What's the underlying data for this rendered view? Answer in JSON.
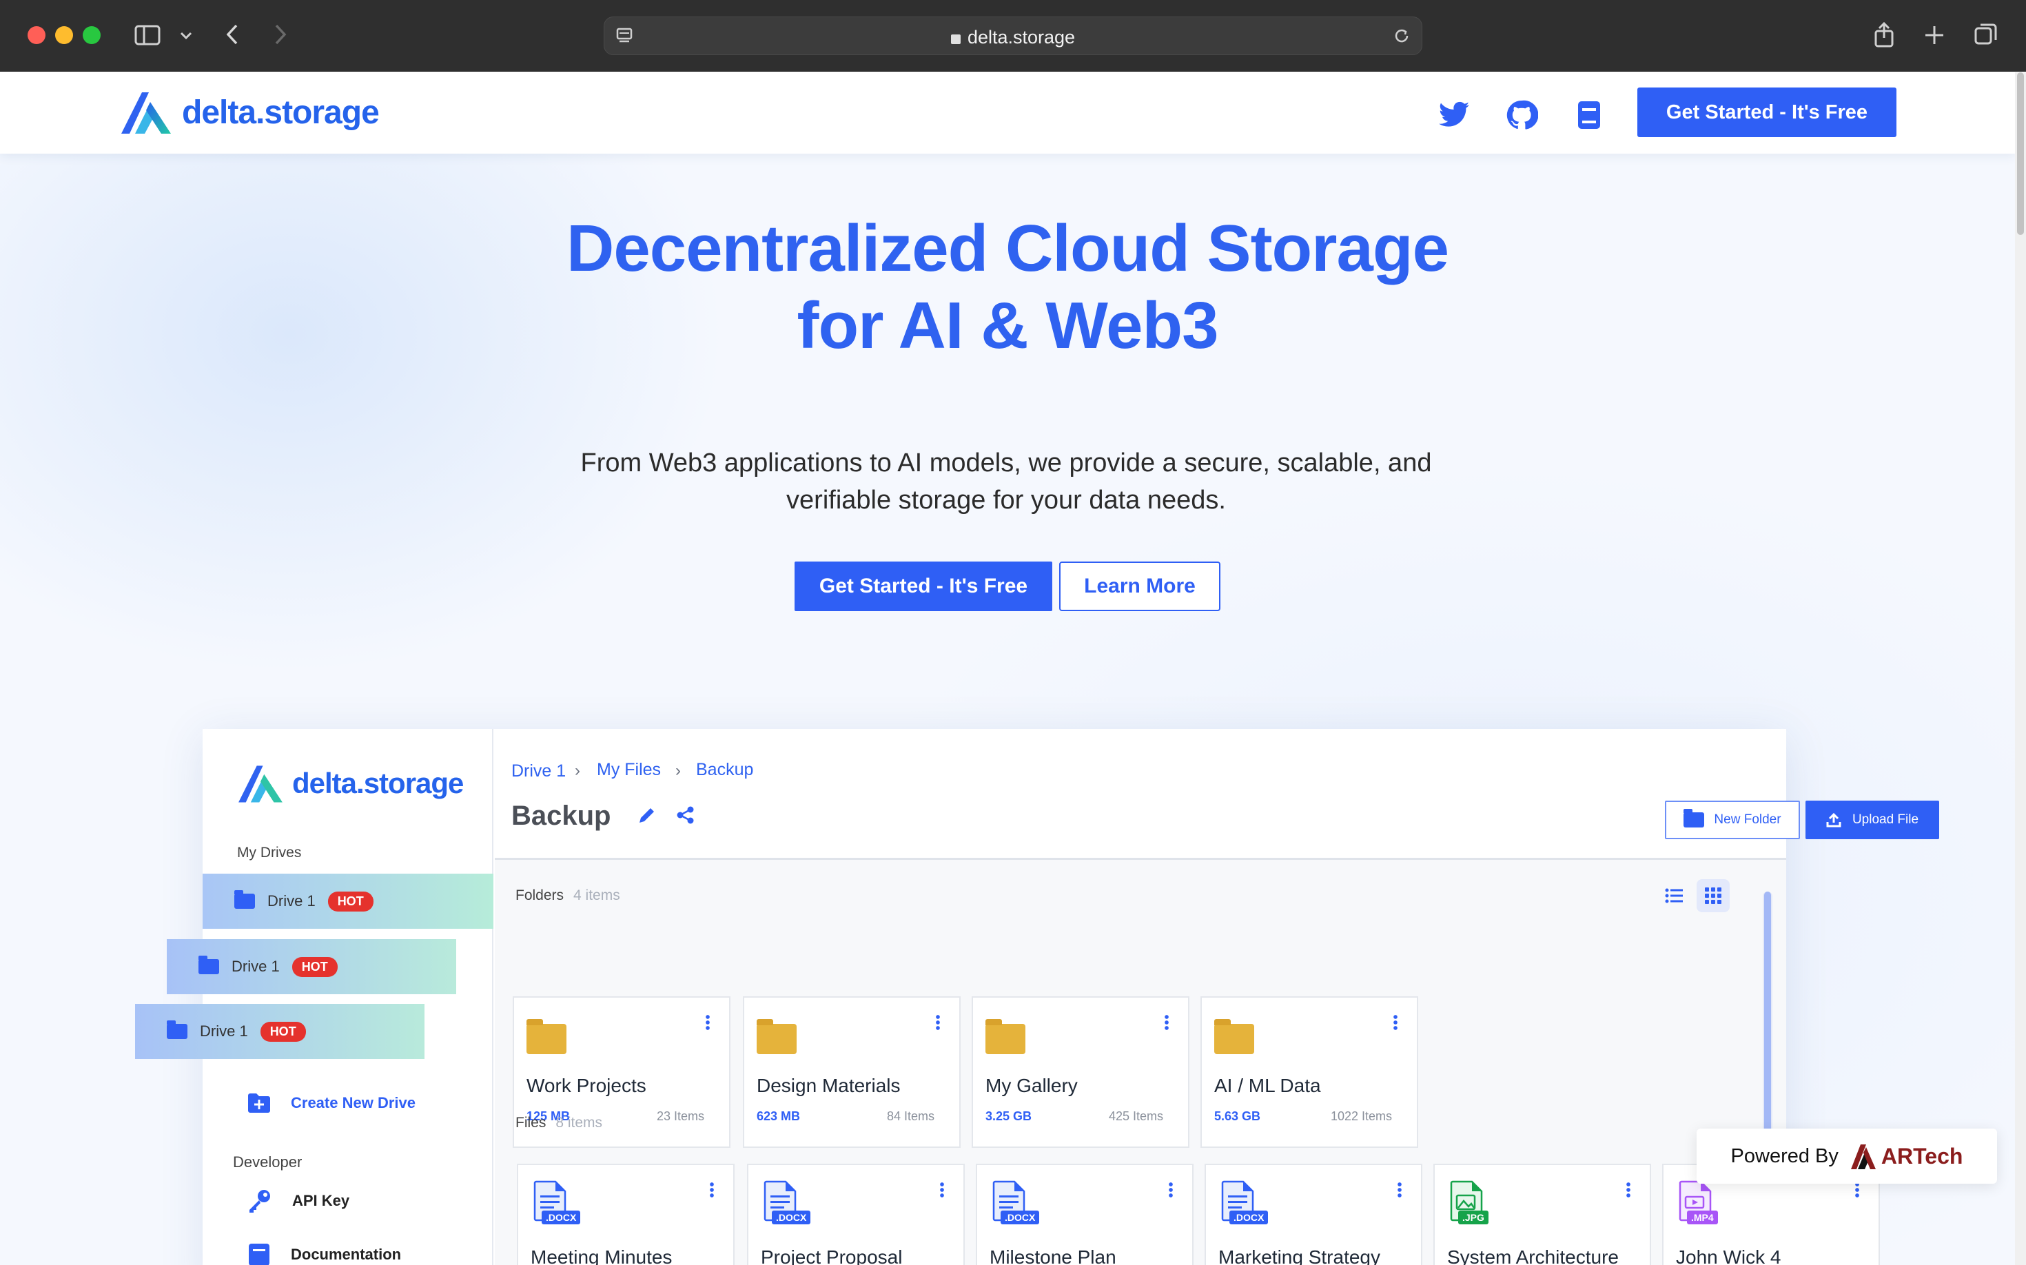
{
  "browser": {
    "url": "delta.storage",
    "colors": {
      "chrome_bg": "#2f2f2f"
    }
  },
  "site_nav": {
    "logo_text": "delta.storage",
    "icons": [
      "twitter-icon",
      "github-icon",
      "docs-book-icon"
    ],
    "cta_label": "Get Started - It's Free"
  },
  "hero": {
    "title_line1": "Decentralized Cloud Storage",
    "title_line2": "for AI & Web3",
    "subtitle_line1": "From Web3 applications to AI models, we provide a secure, scalable, and",
    "subtitle_line2": "verifiable storage for your data needs.",
    "primary_label": "Get Started - It's Free",
    "secondary_label": "Learn More"
  },
  "app": {
    "logo_text": "delta.storage",
    "sidebar": {
      "my_drives_label": "My Drives",
      "drives": [
        {
          "label": "Drive 1",
          "badge": "HOT"
        },
        {
          "label": "Drive 1",
          "badge": "HOT"
        },
        {
          "label": "Drive 1",
          "badge": "HOT"
        }
      ],
      "create_drive_label": "Create New Drive",
      "developer_label": "Developer",
      "api_key_label": "API Key",
      "documentation_label": "Documentation"
    },
    "breadcrumb": [
      "Drive 1",
      "My Files",
      "Backup"
    ],
    "title": "Backup",
    "new_folder_label": "New Folder",
    "upload_file_label": "Upload File",
    "folders_label": "Folders",
    "folders_count": "4 items",
    "folders": [
      {
        "name": "Work Projects",
        "size": "125 MB",
        "items": "23 Items"
      },
      {
        "name": "Design Materials",
        "size": "623 MB",
        "items": "84 Items"
      },
      {
        "name": "My Gallery",
        "size": "3.25 GB",
        "items": "425 Items"
      },
      {
        "name": "AI / ML Data",
        "size": "5.63 GB",
        "items": "1022 Items"
      }
    ],
    "files_label": "Files",
    "files_count": "8 items",
    "files": [
      {
        "name": "Meeting Minutes",
        "ext": ".DOCX",
        "color": "#2f5ff5"
      },
      {
        "name": "Project Proposal",
        "ext": ".DOCX",
        "color": "#2f5ff5"
      },
      {
        "name": "Milestone Plan",
        "ext": ".DOCX",
        "color": "#2f5ff5"
      },
      {
        "name": "Marketing Strategy",
        "ext": ".DOCX",
        "color": "#2f5ff5"
      },
      {
        "name": "System Architecture",
        "ext": ".JPG",
        "color": "#16a34a"
      },
      {
        "name": "John Wick 4",
        "ext": ".MP4",
        "color": "#a855f7"
      }
    ]
  },
  "powered_by": {
    "label": "Powered By",
    "brand": "ARTech"
  },
  "colors": {
    "accent": "#2f5ff5",
    "hot_badge": "#e5322d",
    "folder": "#e5b33b"
  }
}
